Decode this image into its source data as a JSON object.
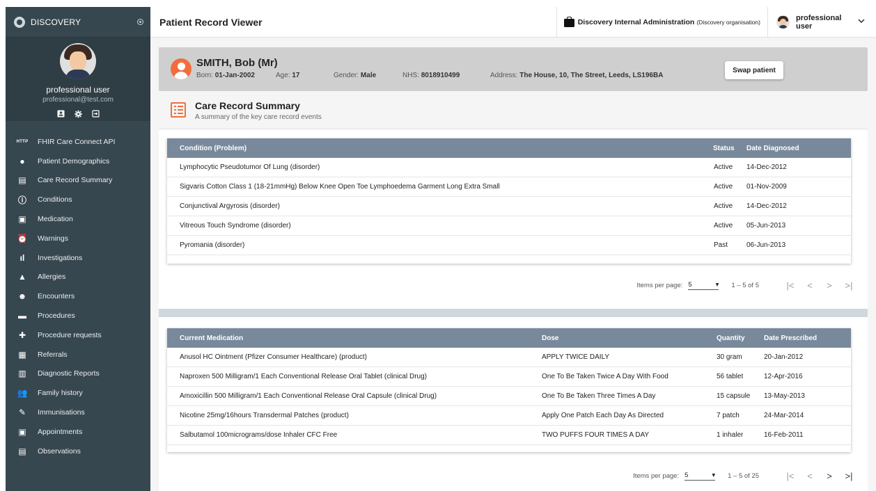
{
  "brand": {
    "name": "DISCOVERY"
  },
  "profile": {
    "name": "professional user",
    "email": "professional@test.com"
  },
  "nav": [
    {
      "label": "FHIR Care Connect API",
      "icon": "http-icon",
      "glyph": "HTTP"
    },
    {
      "label": "Patient Demographics",
      "icon": "account-circle-icon",
      "glyph": "●"
    },
    {
      "label": "Care Record Summary",
      "icon": "list-alt-icon",
      "glyph": "▤"
    },
    {
      "label": "Conditions",
      "icon": "error-outline-icon",
      "glyph": "ⓘ"
    },
    {
      "label": "Medication",
      "icon": "medication-icon",
      "glyph": "▣"
    },
    {
      "label": "Warnings",
      "icon": "alarm-icon",
      "glyph": "⏰"
    },
    {
      "label": "Investigations",
      "icon": "bar-chart-icon",
      "glyph": "ıl"
    },
    {
      "label": "Allergies",
      "icon": "warning-icon",
      "glyph": "▲"
    },
    {
      "label": "Encounters",
      "icon": "face-icon",
      "glyph": "☻"
    },
    {
      "label": "Procedures",
      "icon": "hotel-icon",
      "glyph": "▬"
    },
    {
      "label": "Procedure requests",
      "icon": "local-hospital-icon",
      "glyph": "✚"
    },
    {
      "label": "Referrals",
      "icon": "business-icon",
      "glyph": "▦"
    },
    {
      "label": "Diagnostic Reports",
      "icon": "assessment-icon",
      "glyph": "▥"
    },
    {
      "label": "Family history",
      "icon": "people-outline-icon",
      "glyph": "👥"
    },
    {
      "label": "Immunisations",
      "icon": "colorize-icon",
      "glyph": "✎"
    },
    {
      "label": "Appointments",
      "icon": "event-icon",
      "glyph": "▣"
    },
    {
      "label": "Observations",
      "icon": "event-note-icon",
      "glyph": "▤"
    }
  ],
  "topbar": {
    "title": "Patient Record Viewer",
    "org_name": "Discovery Internal Administration",
    "org_sub": "(Discovery organisation)",
    "user_name": "professional user"
  },
  "patient": {
    "name": "SMITH, Bob (Mr)",
    "born_label": "Born:",
    "born": "01-Jan-2002",
    "age_label": "Age:",
    "age": "17",
    "gender_label": "Gender:",
    "gender": "Male",
    "nhs_label": "NHS:",
    "nhs": "8018910499",
    "address_label": "Address:",
    "address": "The House, 10, The Street, Leeds, LS196BA",
    "swap_label": "Swap patient"
  },
  "section": {
    "title": "Care Record Summary",
    "subtitle": "A summary of the key care record events"
  },
  "conditions": {
    "headers": [
      "Condition (Problem)",
      "Status",
      "Date Diagnosed"
    ],
    "rows": [
      [
        "Lymphocytic Pseudotumor Of Lung (disorder)",
        "Active",
        "14-Dec-2012"
      ],
      [
        "Sigvaris Cotton Class 1 (18-21mmHg) Below Knee Open Toe Lymphoedema Garment Long Extra Small",
        "Active",
        "01-Nov-2009"
      ],
      [
        "Conjunctival Argyrosis (disorder)",
        "Active",
        "14-Dec-2012"
      ],
      [
        "Vitreous Touch Syndrome (disorder)",
        "Active",
        "05-Jun-2013"
      ],
      [
        "Pyromania (disorder)",
        "Past",
        "06-Jun-2013"
      ]
    ],
    "pager": {
      "label": "Items per page:",
      "size": "5",
      "range": "1 – 5 of 5"
    }
  },
  "medication": {
    "headers": [
      "Current Medication",
      "Dose",
      "Quantity",
      "Date Prescribed"
    ],
    "rows": [
      [
        "Anusol HC Ointment (Pfizer Consumer Healthcare) (product)",
        "APPLY TWICE DAILY",
        "30 gram",
        "20-Jan-2012"
      ],
      [
        "Naproxen 500 Milligram/1 Each Conventional Release Oral Tablet (clinical Drug)",
        "One To Be Taken Twice A Day With Food",
        "56 tablet",
        "12-Apr-2016"
      ],
      [
        "Amoxicillin 500 Milligram/1 Each Conventional Release Oral Capsule (clinical Drug)",
        "One To Be Taken Three Times A Day",
        "15 capsule",
        "13-May-2013"
      ],
      [
        "Nicotine 25mg/16hours Transdermal Patches (product)",
        "Apply One Patch Each Day As Directed",
        "7 patch",
        "24-Mar-2014"
      ],
      [
        "Salbutamol 100micrograms/dose Inhaler CFC Free",
        "TWO PUFFS FOUR TIMES A DAY",
        "1 inhaler",
        "16-Feb-2011"
      ]
    ],
    "pager": {
      "label": "Items per page:",
      "size": "5",
      "range": "1 – 5 of 25"
    }
  },
  "colors": {
    "sidebar": "#37474f",
    "accent": "#f26d3d",
    "table_header": "#78899b"
  }
}
